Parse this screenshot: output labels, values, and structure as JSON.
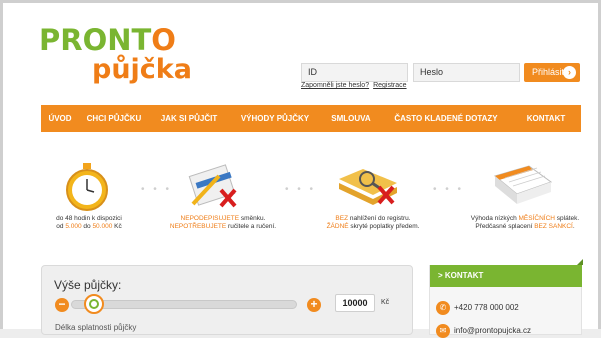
{
  "logo": {
    "line1_a": "PRONT",
    "line1_b": "O",
    "line2": "půjčka"
  },
  "login": {
    "id_value": "ID",
    "password_value": "Heslo",
    "forgot": "Zapomněli jste heslo?",
    "register": "Registrace",
    "button": "Přihlásit",
    "button_arrow": "›"
  },
  "nav": [
    "ÚVOD",
    "CHCI PŮJČKU",
    "JAK SI PŮJČIT",
    "VÝHODY PŮJČKY",
    "SMLOUVA",
    "ČASTO KLADENÉ DOTAZY",
    "KONTAKT"
  ],
  "features": [
    {
      "icon": "stopwatch-icon",
      "line1a": "do 48 hodin k dispozici",
      "line2a": "od ",
      "line2b": "5.000",
      "line2c": " do ",
      "line2d": "50.000",
      "line2e": " Kč"
    },
    {
      "icon": "signing-contract-icon",
      "line1a": "NEPODEPISUJETE",
      "line1b": " směnku.",
      "line2a": "NEPOTŘEBUJETE",
      "line2b": " ručitele a ručení."
    },
    {
      "icon": "folder-search-icon",
      "line1a": "BEZ",
      "line1b": " nahlížení do registru.",
      "line2a": "ŽÁDNÉ",
      "line2b": " skryté poplatky předem."
    },
    {
      "icon": "calendar-icon",
      "line1a": "Výhoda nízkých ",
      "line1b": "MĚSÍČNÍCH",
      "line1c": " splátek.",
      "line2a": "Předčasné splacení ",
      "line2b": "BEZ SANKCÍ",
      "line2c": "."
    }
  ],
  "dots": "• • •",
  "loan": {
    "title": "Výše půjčky:",
    "amount": "10000",
    "currency": "Kč",
    "next_label": "Délka splatnosti půjčky",
    "minus": "−",
    "plus": "+",
    "slider_fraction": 0.06
  },
  "contact": {
    "header": "> KONTAKT",
    "phone": "+420 778 000 002",
    "email": "info@prontopujcka.cz"
  },
  "colors": {
    "orange": "#f18b1f",
    "green": "#7ab531"
  }
}
